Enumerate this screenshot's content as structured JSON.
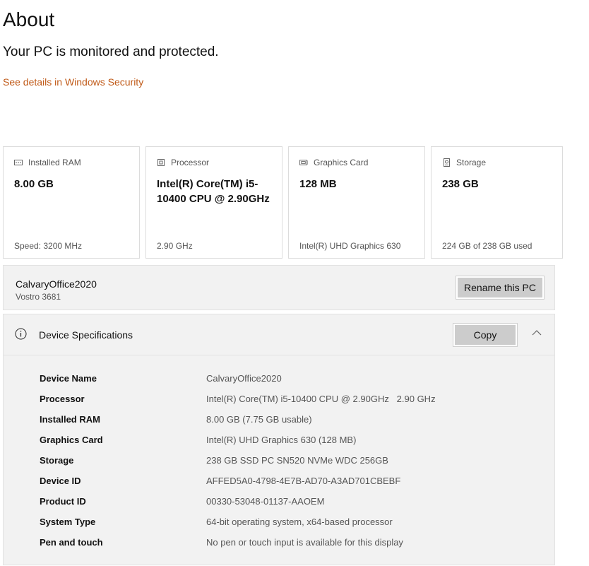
{
  "header": {
    "title": "About",
    "status": "Your PC is monitored and protected.",
    "security_link": "See details in Windows Security"
  },
  "colors": {
    "link": "#c05a18",
    "panel": "#f2f2f2",
    "button": "#cccccc"
  },
  "cards": [
    {
      "label": "Installed RAM",
      "icon": "ram-icon",
      "value": "8.00 GB",
      "footer": "Speed: 3200 MHz"
    },
    {
      "label": "Processor",
      "icon": "processor-icon",
      "value": "Intel(R) Core(TM) i5-10400 CPU @ 2.90GHz",
      "footer": "2.90 GHz"
    },
    {
      "label": "Graphics Card",
      "icon": "graphics-card-icon",
      "value": "128 MB",
      "footer": "Intel(R) UHD Graphics 630"
    },
    {
      "label": "Storage",
      "icon": "storage-icon",
      "value": "238 GB",
      "footer": "224 GB of 238 GB used"
    }
  ],
  "device": {
    "name": "CalvaryOffice2020",
    "model": "Vostro 3681",
    "rename_label": "Rename this PC"
  },
  "specs": {
    "title": "Device Specifications",
    "copy_label": "Copy",
    "rows": [
      {
        "key": "Device Name",
        "value": "CalvaryOffice2020"
      },
      {
        "key": "Processor",
        "value": "Intel(R) Core(TM) i5-10400 CPU @ 2.90GHz   2.90 GHz"
      },
      {
        "key": "Installed RAM",
        "value": "8.00 GB (7.75 GB usable)"
      },
      {
        "key": "Graphics Card",
        "value": "Intel(R) UHD Graphics 630 (128 MB)"
      },
      {
        "key": "Storage",
        "value": "238 GB SSD PC SN520 NVMe WDC 256GB"
      },
      {
        "key": "Device ID",
        "value": "AFFED5A0-4798-4E7B-AD70-A3AD701CBEBF"
      },
      {
        "key": "Product ID",
        "value": "00330-53048-01137-AAOEM"
      },
      {
        "key": "System Type",
        "value": "64-bit operating system, x64-based processor"
      },
      {
        "key": "Pen and touch",
        "value": "No pen or touch input is available for this display"
      }
    ]
  }
}
